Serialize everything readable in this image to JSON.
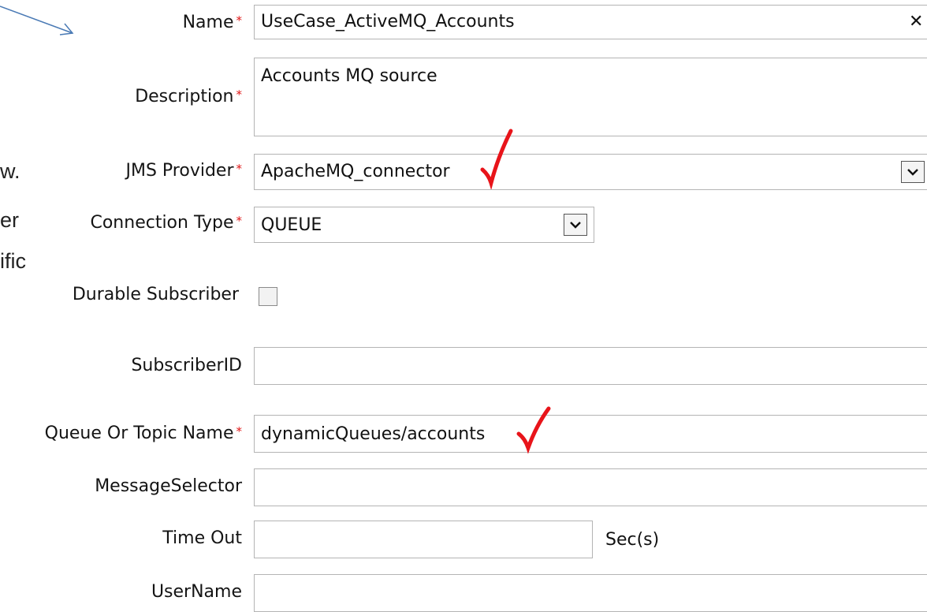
{
  "side_text": [
    "w.",
    "er",
    "ific"
  ],
  "form": {
    "required_marker": "*",
    "name": {
      "label": "Name",
      "value": "UseCase_ActiveMQ_Accounts",
      "clear_glyph": "✕"
    },
    "description": {
      "label": "Description",
      "value": "Accounts MQ source"
    },
    "jms_provider": {
      "label": "JMS Provider",
      "value": "ApacheMQ_connector"
    },
    "connection_type": {
      "label": "Connection Type",
      "value": "QUEUE"
    },
    "durable_subscriber": {
      "label": "Durable Subscriber",
      "checked": false
    },
    "subscriber_id": {
      "label": "SubscriberID",
      "value": ""
    },
    "queue_or_topic": {
      "label": "Queue Or Topic Name",
      "value": "dynamicQueues/accounts"
    },
    "message_selector": {
      "label": "MessageSelector",
      "value": ""
    },
    "time_out": {
      "label": "Time Out",
      "value": "",
      "unit": "Sec(s)"
    },
    "username": {
      "label": "UserName",
      "value": ""
    }
  },
  "colors": {
    "required": "#e01515",
    "checkmark": "#e8141a",
    "arrow": "#4a7ab5",
    "border": "#b4b4b4"
  }
}
